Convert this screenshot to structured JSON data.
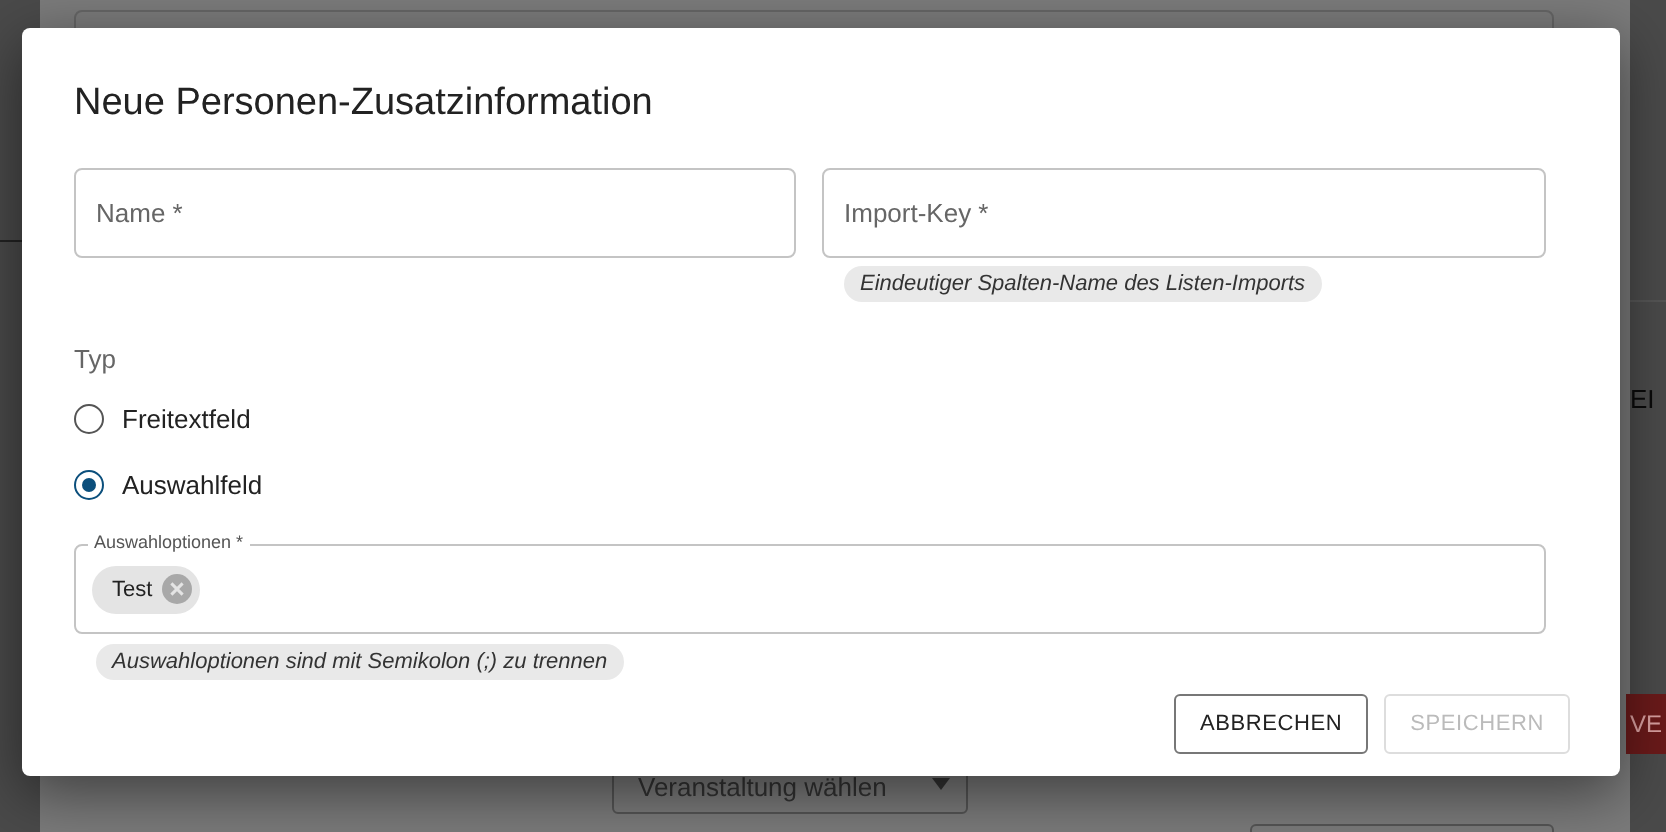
{
  "background": {
    "side_label": "EI",
    "button": "VE",
    "select": "Veranstaltung wählen"
  },
  "dialog": {
    "title": "Neue Personen-Zusatzinformation",
    "fields": [
      {
        "label": "Name *"
      },
      {
        "label": "Import-Key *",
        "hint": "Eindeutiger Spalten-Name des Listen-Imports"
      }
    ],
    "type_group": {
      "label": "Typ",
      "options": [
        {
          "label": "Freitextfeld",
          "selected": false
        },
        {
          "label": "Auswahlfeld",
          "selected": true
        }
      ]
    },
    "options_field": {
      "label": "Auswahloptionen *",
      "chips": [
        "Test"
      ],
      "hint": "Auswahloptionen sind mit Semikolon (;) zu trennen"
    },
    "buttons": [
      {
        "label": "ABBRECHEN",
        "disabled": false
      },
      {
        "label": "SPEICHERN",
        "disabled": true
      }
    ]
  }
}
